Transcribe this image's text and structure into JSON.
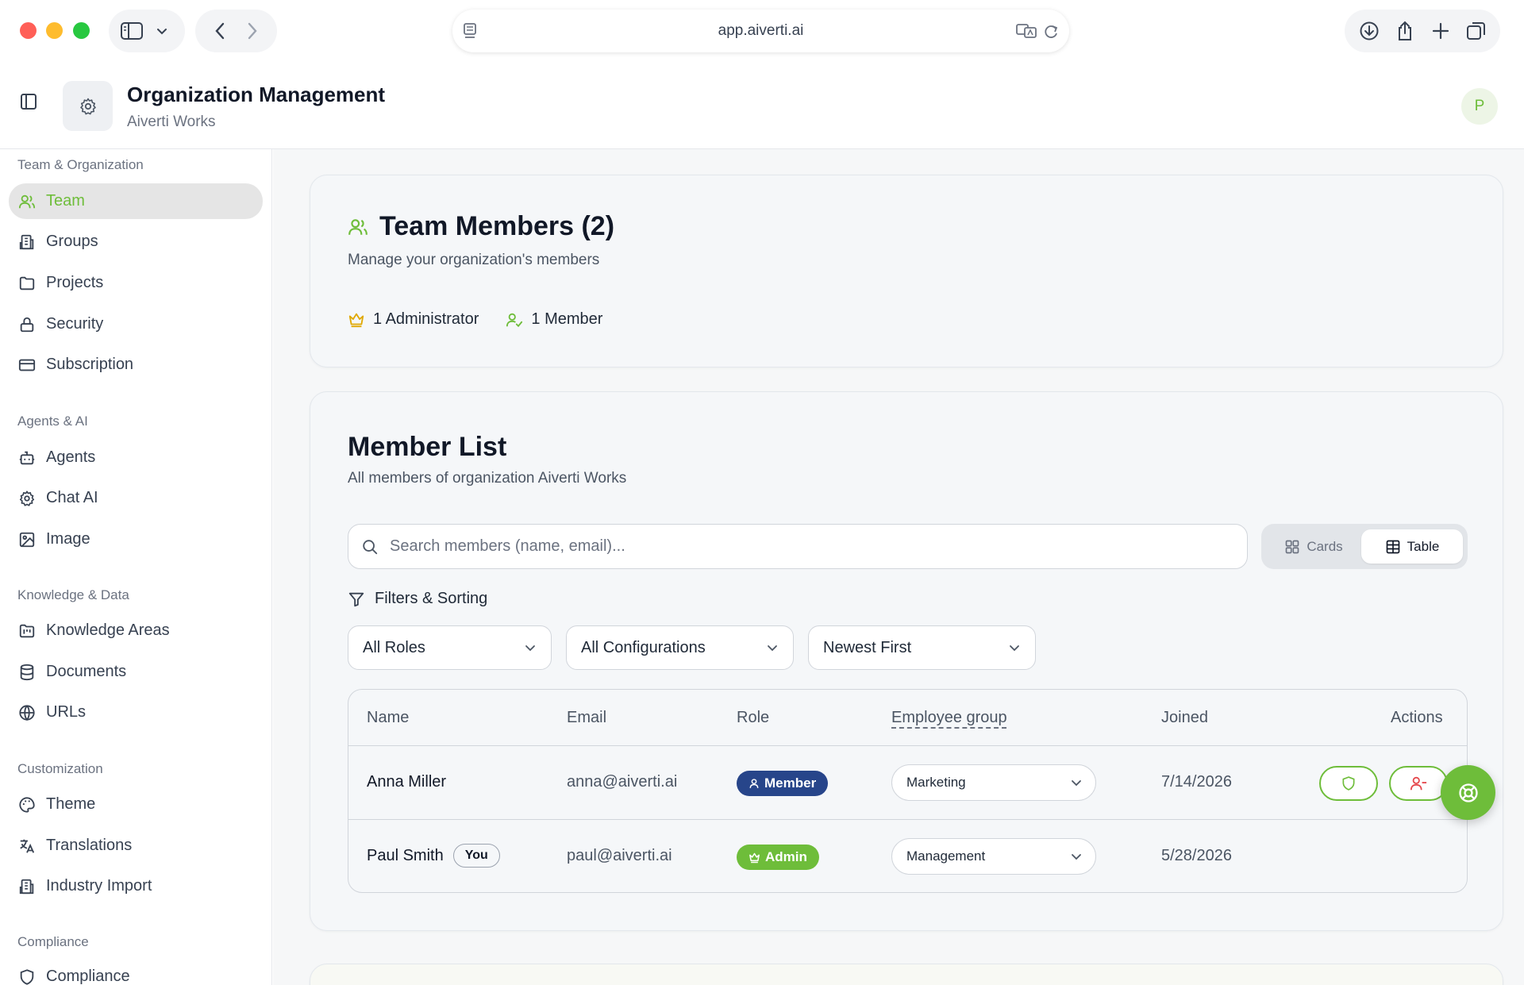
{
  "browser": {
    "url": "app.aiverti.ai"
  },
  "header": {
    "title": "Organization Management",
    "subtitle": "Aiverti Works",
    "avatar_initial": "P"
  },
  "sidebar": {
    "sections": [
      {
        "label": "Team & Organization",
        "items": [
          {
            "label": "Team",
            "icon": "users-icon",
            "active": true
          },
          {
            "label": "Groups",
            "icon": "building-icon"
          },
          {
            "label": "Projects",
            "icon": "folder-icon"
          },
          {
            "label": "Security",
            "icon": "lock-icon"
          },
          {
            "label": "Subscription",
            "icon": "credit-card-icon"
          }
        ]
      },
      {
        "label": "Agents & AI",
        "items": [
          {
            "label": "Agents",
            "icon": "bot-icon"
          },
          {
            "label": "Chat AI",
            "icon": "gear-icon"
          },
          {
            "label": "Image",
            "icon": "image-icon"
          }
        ]
      },
      {
        "label": "Knowledge & Data",
        "items": [
          {
            "label": "Knowledge Areas",
            "icon": "folder-kanban-icon"
          },
          {
            "label": "Documents",
            "icon": "database-icon"
          },
          {
            "label": "URLs",
            "icon": "globe-icon"
          }
        ]
      },
      {
        "label": "Customization",
        "items": [
          {
            "label": "Theme",
            "icon": "palette-icon"
          },
          {
            "label": "Translations",
            "icon": "languages-icon"
          },
          {
            "label": "Industry Import",
            "icon": "building-icon"
          }
        ]
      },
      {
        "label": "Compliance",
        "items": [
          {
            "label": "Compliance",
            "icon": "shield-icon"
          }
        ]
      }
    ]
  },
  "team_card": {
    "title": "Team Members (2)",
    "subtitle": "Manage your organization's members",
    "admin_count": "1 Administrator",
    "member_count": "1 Member"
  },
  "member_list": {
    "title": "Member List",
    "subtitle": "All members of organization Aiverti Works",
    "search_placeholder": "Search members (name, email)...",
    "view_cards": "Cards",
    "view_table": "Table",
    "active_view": "Table",
    "filters_label": "Filters & Sorting",
    "filter_role": "All Roles",
    "filter_config": "All Configurations",
    "sort": "Newest First",
    "columns": [
      "Name",
      "Email",
      "Role",
      "Employee group",
      "Joined",
      "Actions"
    ],
    "rows": [
      {
        "name": "Anna Miller",
        "email": "anna@aiverti.ai",
        "role": "Member",
        "group": "Marketing",
        "joined": "7/14/2026",
        "you": ""
      },
      {
        "name": "Paul Smith",
        "email": "paul@aiverti.ai",
        "role": "Admin",
        "group": "Management",
        "joined": "5/28/2026",
        "you": "You"
      }
    ]
  },
  "colors": {
    "accent_green": "#6ebd3a",
    "member_badge": "#27458a",
    "remove_red": "#e5484d",
    "admin_gold": "#e0a800"
  }
}
